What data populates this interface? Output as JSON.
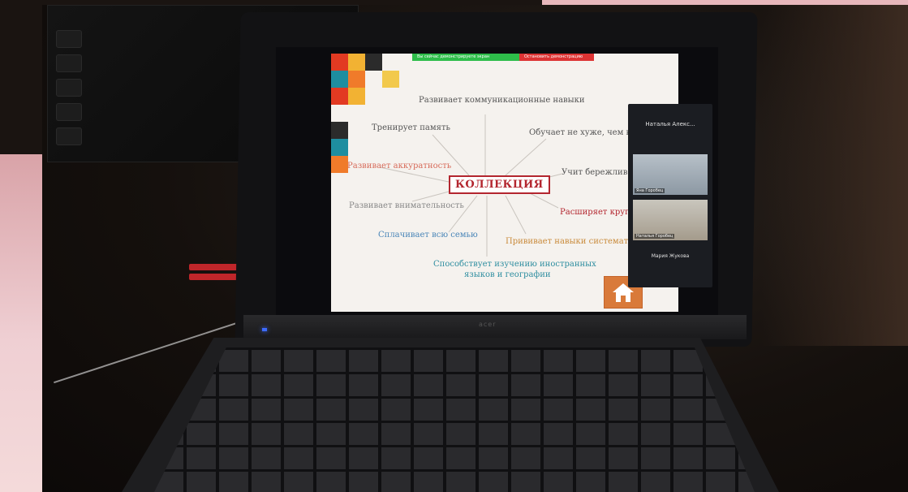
{
  "slide": {
    "center": "КОЛЛЕКЦИЯ",
    "labels": [
      {
        "text": "Развивает коммуникационные навыки",
        "color": "#555555"
      },
      {
        "text": "Тренирует память",
        "color": "#555555"
      },
      {
        "text": "Обучает не хуже, чем в ш",
        "color": "#555555"
      },
      {
        "text": "Развивает аккуратность",
        "color": "#d76b5a"
      },
      {
        "text": "Учит бережливост",
        "color": "#555555"
      },
      {
        "text": "Развивает внимательность",
        "color": "#888888"
      },
      {
        "text": "Расширяет кругоз",
        "color": "#b3262f"
      },
      {
        "text": "Сплачивает всю семью",
        "color": "#4a86b8"
      },
      {
        "text": "Прививает навыки систематиз",
        "color": "#c98a3a"
      },
      {
        "text": "Способствует изучению иностранных",
        "color": "#2f8ea0"
      },
      {
        "text": "языков и географии",
        "color": "#2f8ea0"
      }
    ],
    "topbar": {
      "left": "Вы сейчас демонстрируете экран",
      "right": "Остановить демонстрацию"
    },
    "squares": [
      "#e23a22",
      "#f2b233",
      "#2b2b2b",
      "#1e8ea0",
      "#f07b2a",
      "#f2c94c"
    ]
  },
  "video": {
    "header": "Наталья Алекс...",
    "tile1_caption": "Яна Горобец",
    "tile2_caption": "Наталья Горобец",
    "footer": "Мария Жукова"
  },
  "laptop": {
    "brand": "acer"
  }
}
